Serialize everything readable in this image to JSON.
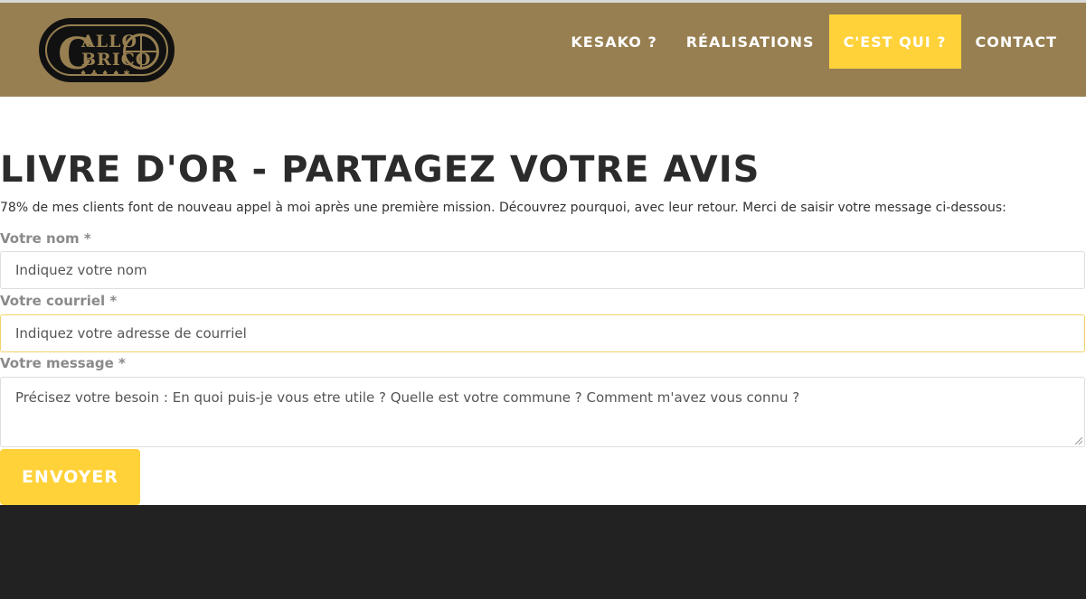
{
  "logo": {
    "c": "C",
    "line1": "ALLO",
    "line2": "BRICO",
    "tools": "♦♣♦♠✱"
  },
  "nav": [
    {
      "label": "KESAKO ?",
      "active": false
    },
    {
      "label": "RÉALISATIONS",
      "active": false
    },
    {
      "label": "C'EST QUI ?",
      "active": true
    },
    {
      "label": "CONTACT",
      "active": false
    }
  ],
  "main": {
    "title": "LIVRE D'OR - PARTAGEZ VOTRE AVIS",
    "intro": "78% de mes clients font de nouveau appel à moi après une première mission. Découvrez pourquoi, avec leur retour. Merci de saisir votre message ci-dessous:"
  },
  "form": {
    "name": {
      "label": "Votre nom *",
      "placeholder": "Indiquez votre nom"
    },
    "email": {
      "label": "Votre courriel *",
      "placeholder": "Indiquez votre adresse de courriel"
    },
    "message": {
      "label": "Votre message *",
      "placeholder": "Précisez votre besoin : En quoi puis-je vous etre utile ? Quelle est votre commune ? Comment m'avez vous connu ?"
    },
    "submit": "ENVOYER"
  },
  "colors": {
    "header": "#977f51",
    "accent": "#ffd23a",
    "footer": "#222222"
  }
}
